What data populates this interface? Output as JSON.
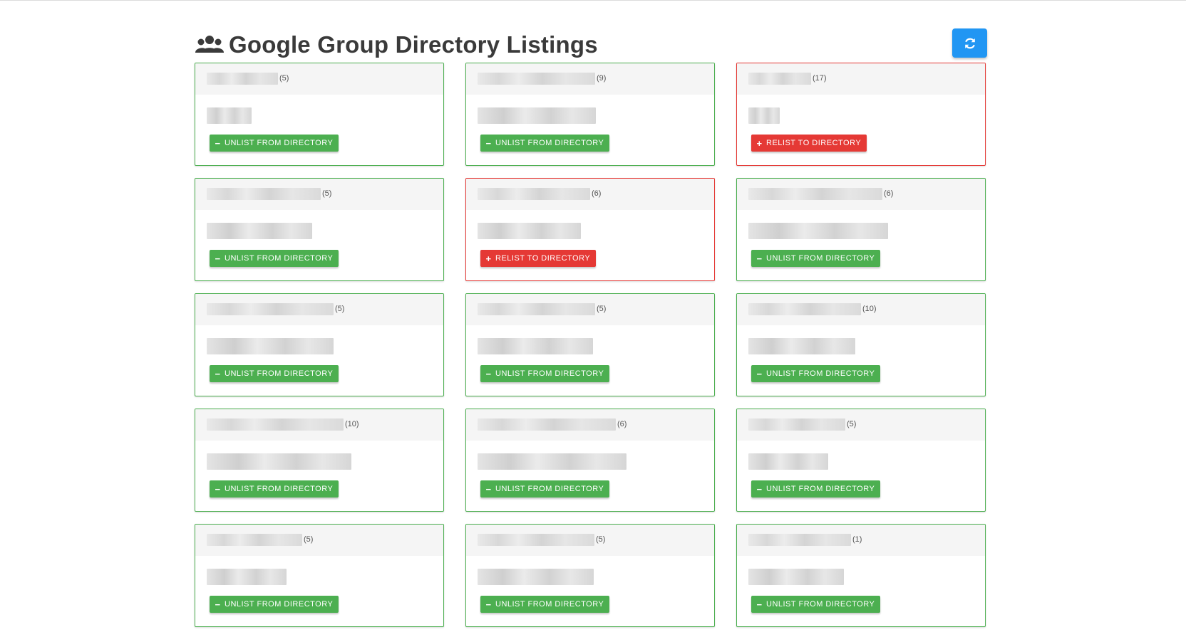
{
  "header": {
    "title": "Google Group Directory Listings",
    "title_icon": "users-icon",
    "refresh_icon": "refresh-icon"
  },
  "colors": {
    "listed": "#4caf50",
    "unlisted": "#e53935",
    "refresh": "#2196f3"
  },
  "labels": {
    "unlist": "UNLIST FROM DIRECTORY",
    "relist": "RELIST TO DIRECTORY"
  },
  "groups": [
    {
      "count": "(5)",
      "listed": true
    },
    {
      "count": "(9)",
      "listed": true
    },
    {
      "count": "(17)",
      "listed": false
    },
    {
      "count": "(5)",
      "listed": true
    },
    {
      "count": "(6)",
      "listed": false
    },
    {
      "count": "(6)",
      "listed": true
    },
    {
      "count": "(5)",
      "listed": true
    },
    {
      "count": "(5)",
      "listed": true
    },
    {
      "count": "(10)",
      "listed": true
    },
    {
      "count": "(10)",
      "listed": true
    },
    {
      "count": "(6)",
      "listed": true
    },
    {
      "count": "(5)",
      "listed": true
    },
    {
      "count": "(5)",
      "listed": true
    },
    {
      "count": "(5)",
      "listed": true
    },
    {
      "count": "(1)",
      "listed": true
    }
  ]
}
